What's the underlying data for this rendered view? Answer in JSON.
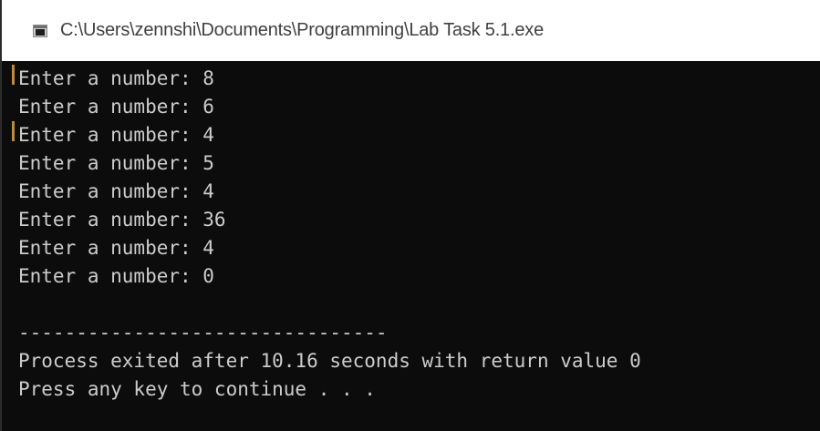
{
  "window": {
    "title": "C:\\Users\\zennshi\\Documents\\Programming\\Lab Task 5.1.exe",
    "icon": "console-app-icon"
  },
  "console": {
    "lines": [
      "Enter a number: 8",
      "Enter a number: 6",
      "Enter a number: 4",
      "Enter a number: 5",
      "Enter a number: 4",
      "Enter a number: 36",
      "Enter a number: 4",
      "Enter a number: 0",
      "",
      "--------------------------------",
      "Process exited after 10.16 seconds with return value 0",
      "Press any key to continue . . ."
    ]
  },
  "colors": {
    "console_bg": "#0c0c0c",
    "console_text": "#cccccc",
    "titlebar_bg": "#ffffff",
    "title_text": "#404040"
  }
}
